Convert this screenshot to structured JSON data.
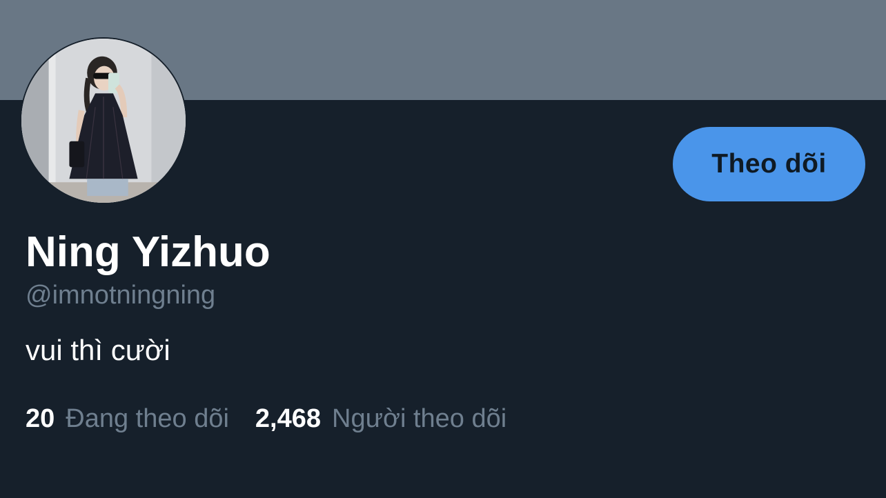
{
  "profile": {
    "display_name": "Ning Yizhuo",
    "handle": "@imnotningning",
    "bio": "vui thì cười",
    "follow_button_label": "Theo dõi"
  },
  "stats": {
    "following_count": "20",
    "following_label": "Đang theo dõi",
    "followers_count": "2,468",
    "followers_label": "Người theo dõi"
  },
  "colors": {
    "background": "#16202b",
    "banner": "#697785",
    "accent": "#4a95ea",
    "secondary_text": "#6f7f8f"
  }
}
